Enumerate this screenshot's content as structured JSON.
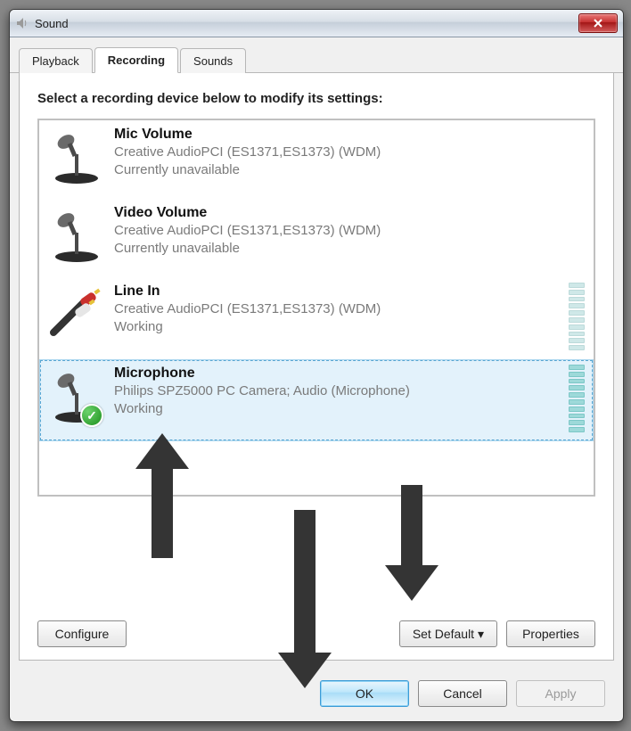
{
  "window": {
    "title": "Sound"
  },
  "tabs": [
    {
      "label": "Playback"
    },
    {
      "label": "Recording"
    },
    {
      "label": "Sounds"
    }
  ],
  "active_tab_index": 1,
  "hint": "Select a recording device below to modify its settings:",
  "devices": [
    {
      "name": "Mic Volume",
      "sub1": "Creative AudioPCI (ES1371,ES1373) (WDM)",
      "sub2": "Currently unavailable",
      "icon": "mic-stand",
      "vu": false,
      "selected": false,
      "default": false
    },
    {
      "name": "Video Volume",
      "sub1": "Creative AudioPCI (ES1371,ES1373) (WDM)",
      "sub2": "Currently unavailable",
      "icon": "mic-stand",
      "vu": false,
      "selected": false,
      "default": false
    },
    {
      "name": "Line In",
      "sub1": "Creative AudioPCI (ES1371,ES1373) (WDM)",
      "sub2": "Working",
      "icon": "rca-cable",
      "vu": true,
      "selected": false,
      "default": false
    },
    {
      "name": "Microphone",
      "sub1": "Philips  SPZ5000  PC Camera; Audio (Microphone)",
      "sub2": "Working",
      "icon": "mic-stand",
      "vu": true,
      "selected": true,
      "default": true
    }
  ],
  "buttons": {
    "configure": "Configure",
    "set_default": "Set Default",
    "properties": "Properties",
    "ok": "OK",
    "cancel": "Cancel",
    "apply": "Apply"
  }
}
